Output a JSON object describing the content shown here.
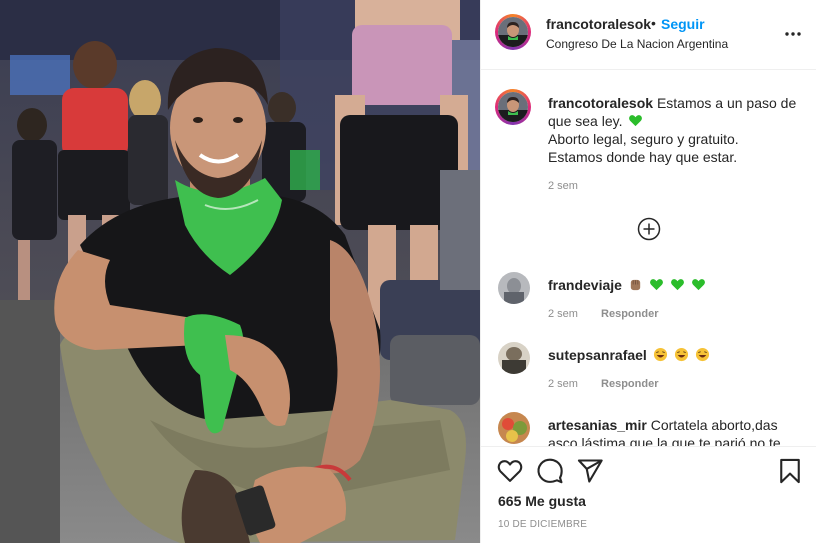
{
  "header": {
    "username": "francotoralesok",
    "separator": "•",
    "follow_label": "Seguir",
    "location": "Congreso De La Nacion Argentina"
  },
  "caption": {
    "username": "francotoralesok",
    "line1": "Estamos a un paso de que sea ley.",
    "line2": "Aborto legal, seguro y gratuito.",
    "line3": "Estamos donde hay que estar.",
    "time": "2 sem"
  },
  "comments": [
    {
      "username": "frandeviaje",
      "time": "2 sem",
      "reply_label": "Responder",
      "emojis": [
        "fist",
        "green-heart",
        "green-heart",
        "green-heart"
      ]
    },
    {
      "username": "sutepsanrafael",
      "time": "2 sem",
      "reply_label": "Responder",
      "emojis": [
        "laughing-face",
        "laughing-face",
        "laughing-face"
      ]
    },
    {
      "username": "artesanias_mir",
      "text": "Cortatela aborto,das asco lástima que la que te parió no te"
    }
  ],
  "stats": {
    "likes": "665 Me gusta",
    "date": "10 DE DICIEMBRE"
  },
  "colors": {
    "link_blue": "#0095f6",
    "text": "#262626",
    "muted": "#8e8e8e",
    "heart_green": "#2bbd2b",
    "bandana_green": "#3fbf4f"
  },
  "icons": {
    "more": "three-dots-icon",
    "add": "plus-circle-icon",
    "like": "heart-icon",
    "comment": "comment-icon",
    "share": "paper-plane-icon",
    "save": "bookmark-icon"
  }
}
